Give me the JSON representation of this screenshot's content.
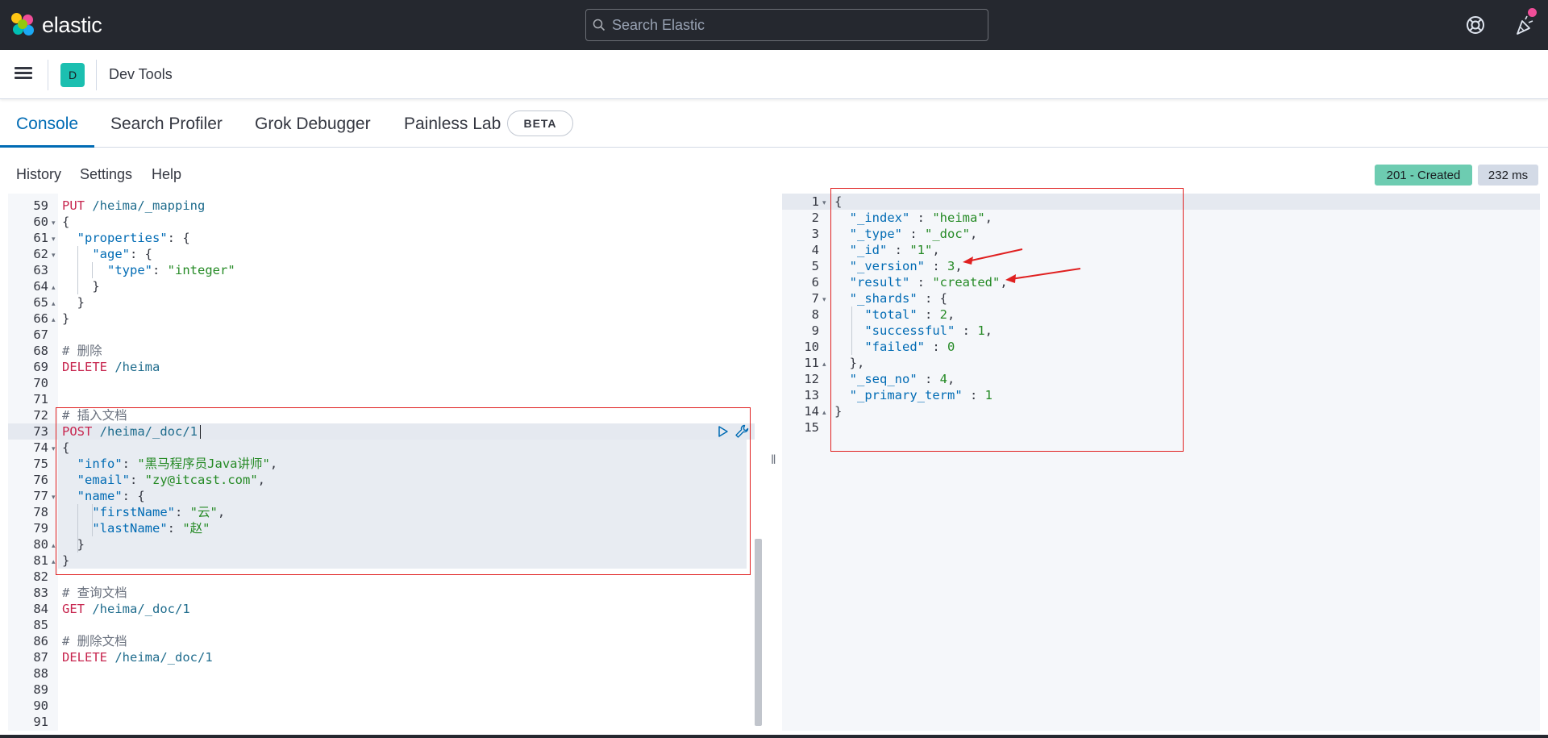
{
  "header": {
    "brand": "elastic",
    "search_placeholder": "Search Elastic",
    "help_icon": "help-icon",
    "news_icon": "newsfeed-icon"
  },
  "breadcrumb": {
    "space_initial": "D",
    "title": "Dev Tools"
  },
  "tabs": [
    {
      "label": "Console",
      "active": true
    },
    {
      "label": "Search Profiler",
      "active": false
    },
    {
      "label": "Grok Debugger",
      "active": false
    },
    {
      "label": "Painless Lab",
      "active": false
    }
  ],
  "beta_label": "BETA",
  "toolbar": {
    "history": "History",
    "settings": "Settings",
    "help": "Help"
  },
  "response_status": {
    "status": "201 - Created",
    "time": "232 ms",
    "status_color": "#6dccb1"
  },
  "request_lines": [
    {
      "n": "59",
      "fold": "",
      "parts": [
        [
          "m",
          "PUT"
        ],
        [
          "b",
          " "
        ],
        [
          "p",
          "/heima/_mapping"
        ]
      ]
    },
    {
      "n": "60",
      "fold": "▾",
      "parts": [
        [
          "b",
          "{"
        ]
      ]
    },
    {
      "n": "61",
      "fold": "▾",
      "parts": [
        [
          "b",
          "  "
        ],
        [
          "kk",
          "\"properties\""
        ],
        [
          "b",
          ": {"
        ]
      ]
    },
    {
      "n": "62",
      "fold": "▾",
      "parts": [
        [
          "b",
          "    "
        ],
        [
          "kk",
          "\"age\""
        ],
        [
          "b",
          ": {"
        ]
      ]
    },
    {
      "n": "63",
      "fold": "",
      "parts": [
        [
          "b",
          "      "
        ],
        [
          "kk",
          "\"type\""
        ],
        [
          "b",
          ": "
        ],
        [
          "s",
          "\"integer\""
        ]
      ]
    },
    {
      "n": "64",
      "fold": "▴",
      "parts": [
        [
          "b",
          "    }"
        ]
      ]
    },
    {
      "n": "65",
      "fold": "▴",
      "parts": [
        [
          "b",
          "  }"
        ]
      ]
    },
    {
      "n": "66",
      "fold": "▴",
      "parts": [
        [
          "b",
          "}"
        ]
      ]
    },
    {
      "n": "67",
      "fold": "",
      "parts": []
    },
    {
      "n": "68",
      "fold": "",
      "parts": [
        [
          "c",
          "# 删除"
        ]
      ]
    },
    {
      "n": "69",
      "fold": "",
      "parts": [
        [
          "m",
          "DELETE"
        ],
        [
          "b",
          " "
        ],
        [
          "p",
          "/heima"
        ]
      ]
    },
    {
      "n": "70",
      "fold": "",
      "parts": []
    },
    {
      "n": "71",
      "fold": "",
      "parts": []
    },
    {
      "n": "72",
      "fold": "",
      "parts": [
        [
          "c",
          "# 插入文档"
        ]
      ]
    },
    {
      "n": "73",
      "fold": "",
      "parts": [
        [
          "m",
          "POST"
        ],
        [
          "b",
          " "
        ],
        [
          "p",
          "/heima/_doc/1"
        ]
      ]
    },
    {
      "n": "74",
      "fold": "▾",
      "parts": [
        [
          "b",
          "{"
        ]
      ]
    },
    {
      "n": "75",
      "fold": "",
      "parts": [
        [
          "b",
          "  "
        ],
        [
          "kk",
          "\"info\""
        ],
        [
          "b",
          ": "
        ],
        [
          "s",
          "\"黑马程序员Java讲师\""
        ],
        [
          "b",
          ","
        ]
      ]
    },
    {
      "n": "76",
      "fold": "",
      "parts": [
        [
          "b",
          "  "
        ],
        [
          "kk",
          "\"email\""
        ],
        [
          "b",
          ": "
        ],
        [
          "s",
          "\"zy@itcast.com\""
        ],
        [
          "b",
          ","
        ]
      ]
    },
    {
      "n": "77",
      "fold": "▾",
      "parts": [
        [
          "b",
          "  "
        ],
        [
          "kk",
          "\"name\""
        ],
        [
          "b",
          ": {"
        ]
      ]
    },
    {
      "n": "78",
      "fold": "",
      "parts": [
        [
          "b",
          "    "
        ],
        [
          "kk",
          "\"firstName\""
        ],
        [
          "b",
          ": "
        ],
        [
          "s",
          "\"云\""
        ],
        [
          "b",
          ","
        ]
      ]
    },
    {
      "n": "79",
      "fold": "",
      "parts": [
        [
          "b",
          "    "
        ],
        [
          "kk",
          "\"lastName\""
        ],
        [
          "b",
          ": "
        ],
        [
          "s",
          "\"赵\""
        ]
      ]
    },
    {
      "n": "80",
      "fold": "▴",
      "parts": [
        [
          "b",
          "  }"
        ]
      ]
    },
    {
      "n": "81",
      "fold": "▴",
      "parts": [
        [
          "b",
          "}"
        ]
      ]
    },
    {
      "n": "82",
      "fold": "",
      "parts": []
    },
    {
      "n": "83",
      "fold": "",
      "parts": [
        [
          "c",
          "# 查询文档"
        ]
      ]
    },
    {
      "n": "84",
      "fold": "",
      "parts": [
        [
          "m",
          "GET"
        ],
        [
          "b",
          " "
        ],
        [
          "p",
          "/heima/_doc/1"
        ]
      ]
    },
    {
      "n": "85",
      "fold": "",
      "parts": []
    },
    {
      "n": "86",
      "fold": "",
      "parts": [
        [
          "c",
          "# 删除文档"
        ]
      ]
    },
    {
      "n": "87",
      "fold": "",
      "parts": [
        [
          "m",
          "DELETE"
        ],
        [
          "b",
          " "
        ],
        [
          "p",
          "/heima/_doc/1"
        ]
      ]
    },
    {
      "n": "88",
      "fold": "",
      "parts": []
    },
    {
      "n": "89",
      "fold": "",
      "parts": []
    },
    {
      "n": "90",
      "fold": "",
      "parts": []
    },
    {
      "n": "91",
      "fold": "",
      "parts": []
    }
  ],
  "response_lines": [
    {
      "n": "1",
      "fold": "▾",
      "parts": [
        [
          "b",
          "{"
        ]
      ]
    },
    {
      "n": "2",
      "fold": "",
      "parts": [
        [
          "b",
          "  "
        ],
        [
          "kk",
          "\"_index\""
        ],
        [
          "b",
          " : "
        ],
        [
          "s",
          "\"heima\""
        ],
        [
          "b",
          ","
        ]
      ]
    },
    {
      "n": "3",
      "fold": "",
      "parts": [
        [
          "b",
          "  "
        ],
        [
          "kk",
          "\"_type\""
        ],
        [
          "b",
          " : "
        ],
        [
          "s",
          "\"_doc\""
        ],
        [
          "b",
          ","
        ]
      ]
    },
    {
      "n": "4",
      "fold": "",
      "parts": [
        [
          "b",
          "  "
        ],
        [
          "kk",
          "\"_id\""
        ],
        [
          "b",
          " : "
        ],
        [
          "s",
          "\"1\""
        ],
        [
          "b",
          ","
        ]
      ]
    },
    {
      "n": "5",
      "fold": "",
      "parts": [
        [
          "b",
          "  "
        ],
        [
          "kk",
          "\"_version\""
        ],
        [
          "b",
          " : "
        ],
        [
          "n",
          "3"
        ],
        [
          "b",
          ","
        ]
      ]
    },
    {
      "n": "6",
      "fold": "",
      "parts": [
        [
          "b",
          "  "
        ],
        [
          "kk",
          "\"result\""
        ],
        [
          "b",
          " : "
        ],
        [
          "s",
          "\"created\""
        ],
        [
          "b",
          ","
        ]
      ]
    },
    {
      "n": "7",
      "fold": "▾",
      "parts": [
        [
          "b",
          "  "
        ],
        [
          "kk",
          "\"_shards\""
        ],
        [
          "b",
          " : {"
        ]
      ]
    },
    {
      "n": "8",
      "fold": "",
      "parts": [
        [
          "b",
          "    "
        ],
        [
          "kk",
          "\"total\""
        ],
        [
          "b",
          " : "
        ],
        [
          "n",
          "2"
        ],
        [
          "b",
          ","
        ]
      ]
    },
    {
      "n": "9",
      "fold": "",
      "parts": [
        [
          "b",
          "    "
        ],
        [
          "kk",
          "\"successful\""
        ],
        [
          "b",
          " : "
        ],
        [
          "n",
          "1"
        ],
        [
          "b",
          ","
        ]
      ]
    },
    {
      "n": "10",
      "fold": "",
      "parts": [
        [
          "b",
          "    "
        ],
        [
          "kk",
          "\"failed\""
        ],
        [
          "b",
          " : "
        ],
        [
          "n",
          "0"
        ]
      ]
    },
    {
      "n": "11",
      "fold": "▴",
      "parts": [
        [
          "b",
          "  },"
        ]
      ]
    },
    {
      "n": "12",
      "fold": "",
      "parts": [
        [
          "b",
          "  "
        ],
        [
          "kk",
          "\"_seq_no\""
        ],
        [
          "b",
          " : "
        ],
        [
          "n",
          "4"
        ],
        [
          "b",
          ","
        ]
      ]
    },
    {
      "n": "13",
      "fold": "",
      "parts": [
        [
          "b",
          "  "
        ],
        [
          "kk",
          "\"_primary_term\""
        ],
        [
          "b",
          " : "
        ],
        [
          "n",
          "1"
        ]
      ]
    },
    {
      "n": "14",
      "fold": "▴",
      "parts": [
        [
          "b",
          "}"
        ]
      ]
    },
    {
      "n": "15",
      "fold": "",
      "parts": []
    }
  ],
  "annotation_color": "#e02020"
}
